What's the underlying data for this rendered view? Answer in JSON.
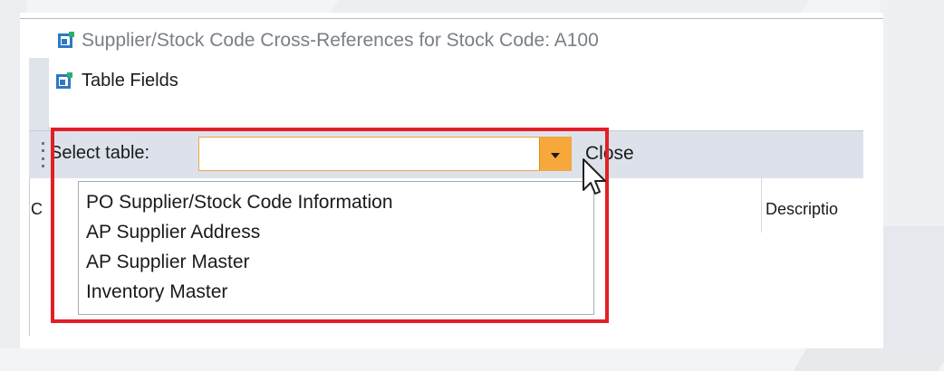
{
  "window": {
    "title": "Supplier/Stock Code Cross-References for Stock Code: A100"
  },
  "panel": {
    "title": "Table Fields"
  },
  "toolbar": {
    "select_label": "Select table:",
    "select_value": "",
    "close_label": "Close"
  },
  "grid": {
    "columns": [
      "C",
      "Descriptio"
    ]
  },
  "dropdown": {
    "options": [
      "PO Supplier/Stock Code Information",
      "AP Supplier Address",
      "AP Supplier Master",
      "Inventory Master"
    ]
  },
  "colors": {
    "highlight": "#e31f26",
    "dropdown_button": "#f7a83a",
    "toolbar": "#dde2ea",
    "icon_blue": "#2e78c4",
    "icon_green": "#27b36b"
  },
  "icons": {
    "app": "syspro-form-icon",
    "panel": "syspro-form-icon",
    "dropdown": "chevron-down-icon",
    "cursor": "mouse-pointer-icon",
    "grip": "toolbar-grip-icon"
  }
}
